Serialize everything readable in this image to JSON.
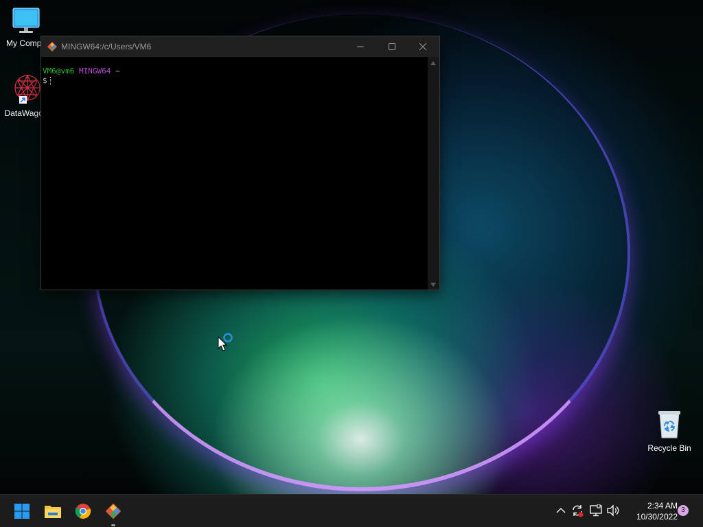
{
  "desktop": {
    "icons": [
      {
        "name": "my-computer",
        "label": "My Compu",
        "icon": "monitor-icon"
      },
      {
        "name": "datawagon",
        "label": "DataWagon",
        "icon": "datawagon-icon"
      },
      {
        "name": "recycle-bin",
        "label": "Recycle Bin",
        "icon": "recycle-bin-icon"
      }
    ]
  },
  "terminal": {
    "title": "MINGW64:/c/Users/VM6",
    "prompt_user": "VM6@vm6",
    "prompt_system": "MINGW64",
    "prompt_path": "~",
    "prompt_symbol": "$"
  },
  "taskbar": {
    "apps": [
      "start-icon",
      "file-explorer-icon",
      "chrome-icon",
      "git-bash-icon"
    ],
    "tray": [
      "chevron-up-icon",
      "sync-icon",
      "network-icon",
      "volume-icon"
    ],
    "time": "2:34 AM",
    "date": "10/30/2022",
    "notification_count": "3"
  },
  "colors": {
    "prompt_user": "#2fb82f",
    "prompt_system": "#b64bd3",
    "titlebar": "#202020",
    "taskbar": "#1c1c1c"
  }
}
